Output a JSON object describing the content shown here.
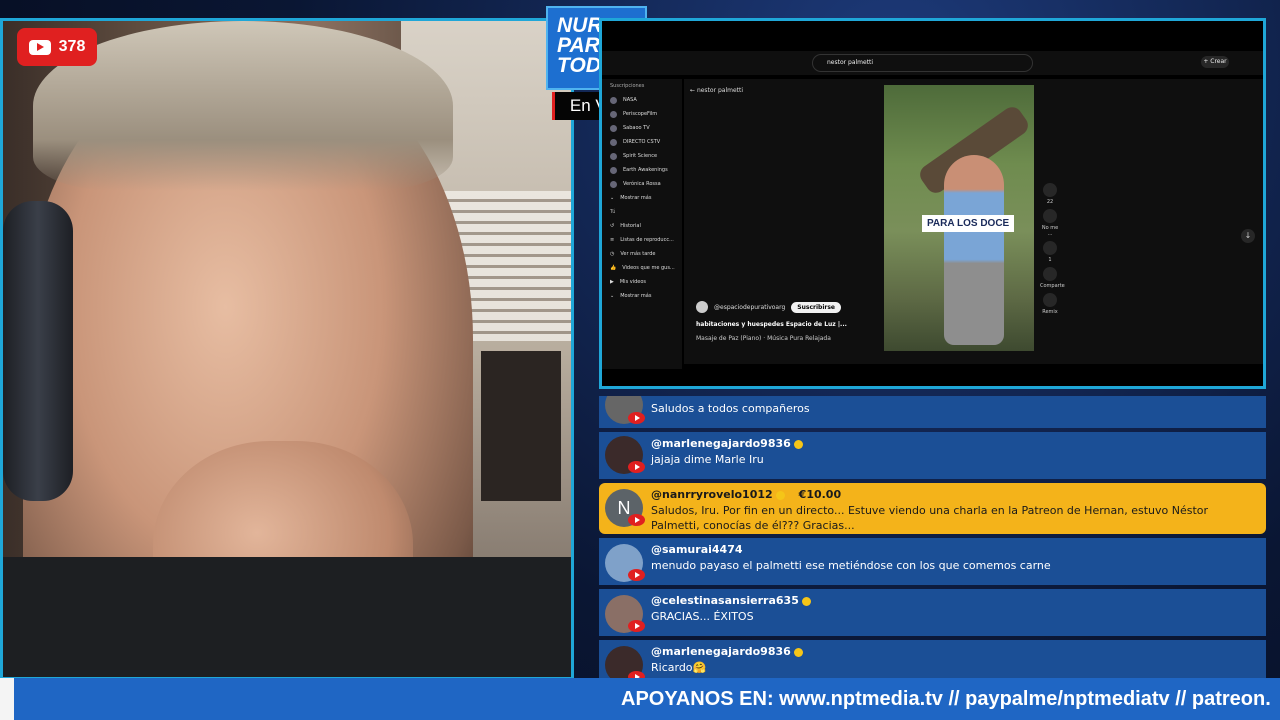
{
  "stream": {
    "viewers": "378",
    "logo_lines": [
      "NUR",
      "PARA",
      "TODOS"
    ],
    "live_label": "En Vivo",
    "ticker": "APOYANOS EN: www.nptmedia.tv // paypalme/nptmediatv // patreon."
  },
  "youtube": {
    "search_value": "nestor palmetti",
    "back_label": "nestor palmetti",
    "create_label": "+ Crear",
    "subscriptions_label": "Suscripciones",
    "subscriptions": [
      "NASA",
      "PeriscopeFilm",
      "Sabaoo TV",
      "DIRECTO CSTV",
      "Spirit Science",
      "Earth Awakenings",
      "Verónica Rossa"
    ],
    "show_more": "Mostrar más",
    "you_label": "Tú",
    "you_items": [
      "Historial",
      "Listas de reproducc...",
      "Ver más tarde",
      "Videos que me gus...",
      "Mis videos",
      "Mostrar más"
    ],
    "video_overlay": "PARA LOS DOCE",
    "channel": "@espaciodepurativoarg",
    "subscribe": "Suscribirse",
    "video_title": "habitaciones y huespedes Espacio de Luz |...",
    "music": "Masaje de Paz (Piano) · Música Pura Relajada",
    "rail": {
      "likes": "22",
      "dislike": "No me ...",
      "comments": "1",
      "share": "Comparte",
      "remix": "Remix"
    }
  },
  "chat": [
    {
      "user": "",
      "text": "Saludos a todos compañeros",
      "highlight": false
    },
    {
      "user": "@marlenegajardo9836",
      "text": "jajaja dime Marle Iru",
      "highlight": false
    },
    {
      "user": "@nanrryrovelo1012",
      "amount": "€10.00",
      "text": "Saludos, Iru. Por fin en un directo... Estuve viendo una charla en la Patreon de Hernan, estuvo Néstor Palmetti, conocías de él??? Gracias...",
      "highlight": true,
      "initial": "N"
    },
    {
      "user": "@samurai4474",
      "text": "menudo payaso el palmetti ese metiéndose con los que comemos carne",
      "highlight": false
    },
    {
      "user": "@celestinasansierra635",
      "text": "GRACIAS... ÉXITOS",
      "highlight": false
    },
    {
      "user": "@marlenegajardo9836",
      "text": "Ricardo🤗",
      "highlight": false
    }
  ],
  "colors": {
    "chat_bg": "#1b4f96",
    "superchat": "#f4b31a",
    "frame": "#1fa7d8",
    "ticker": "#1f66c4"
  }
}
